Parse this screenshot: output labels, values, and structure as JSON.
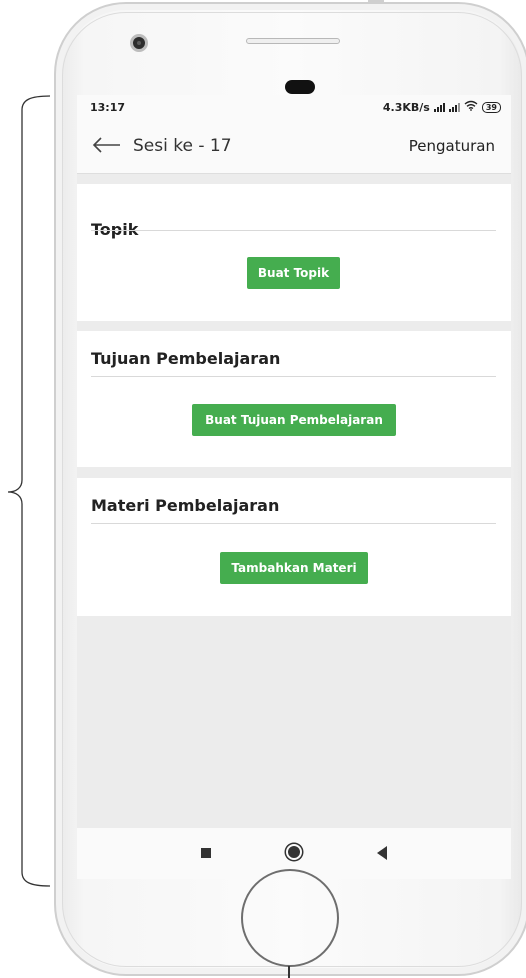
{
  "status": {
    "time": "13:17",
    "speed": "4.3KB/s",
    "battery": "39"
  },
  "appbar": {
    "title": "Sesi ke - 17",
    "settings_label": "Pengaturan"
  },
  "sections": {
    "topic": {
      "heading": "Topik",
      "button": "Buat Topik"
    },
    "goals": {
      "heading": "Tujuan Pembelajaran",
      "button": "Buat Tujuan Pembelajaran"
    },
    "materials": {
      "heading": "Materi Pembelajaran",
      "button": "Tambahkan Materi"
    }
  },
  "navbar": {
    "icons": [
      "recent-apps-icon",
      "home-icon",
      "back-triangle-icon"
    ]
  },
  "colors": {
    "accent_button": "#45ad4f",
    "screen_background": "#ececec"
  }
}
